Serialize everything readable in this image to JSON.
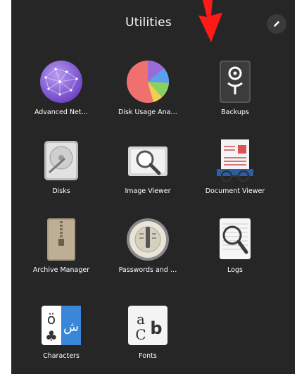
{
  "folder": {
    "title": "Utilities",
    "edit_button_icon": "pencil-icon"
  },
  "apps": [
    {
      "label": "Advanced Net…",
      "icon": "network-globe-icon"
    },
    {
      "label": "Disk Usage Ana…",
      "icon": "disk-usage-pie-icon"
    },
    {
      "label": "Backups",
      "icon": "backups-safe-icon"
    },
    {
      "label": "Disks",
      "icon": "disks-hdd-icon"
    },
    {
      "label": "Image Viewer",
      "icon": "image-viewer-icon"
    },
    {
      "label": "Document Viewer",
      "icon": "document-viewer-icon"
    },
    {
      "label": "Archive Manager",
      "icon": "archive-zip-icon"
    },
    {
      "label": "Passwords and …",
      "icon": "passwords-lock-icon"
    },
    {
      "label": "Logs",
      "icon": "logs-magnifier-icon"
    },
    {
      "label": "Characters",
      "icon": "characters-icon"
    },
    {
      "label": "Fonts",
      "icon": "fonts-icon"
    }
  ],
  "colors": {
    "panel_bg": "#262626",
    "annotation_arrow": "#ff1a1a"
  }
}
